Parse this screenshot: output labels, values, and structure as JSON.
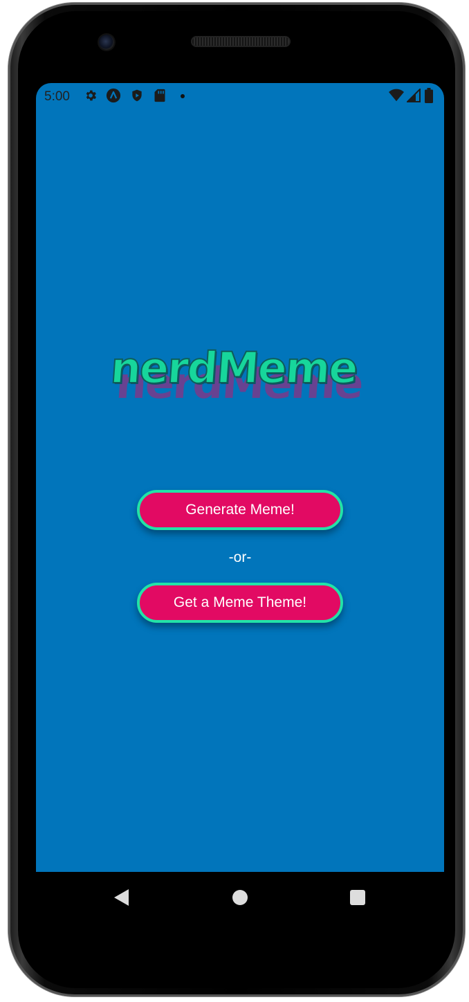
{
  "status_bar": {
    "time": "5:00",
    "icons": [
      "gear-icon",
      "app-a-icon",
      "shield-play-icon",
      "sd-card-icon",
      "notification-dot-icon",
      "wifi-icon",
      "cell-signal-icon",
      "battery-icon"
    ]
  },
  "app": {
    "logo_text": "nerdMeme",
    "generate_button": "Generate Meme!",
    "separator": "-or-",
    "theme_button": "Get a Meme Theme!"
  },
  "navigation": {
    "buttons": [
      "back-icon",
      "home-icon",
      "recents-icon"
    ]
  },
  "colors": {
    "background": "#0175bb",
    "button_fill": "#e20a63",
    "button_border": "#22e3a7",
    "logo": "#17d69b"
  }
}
